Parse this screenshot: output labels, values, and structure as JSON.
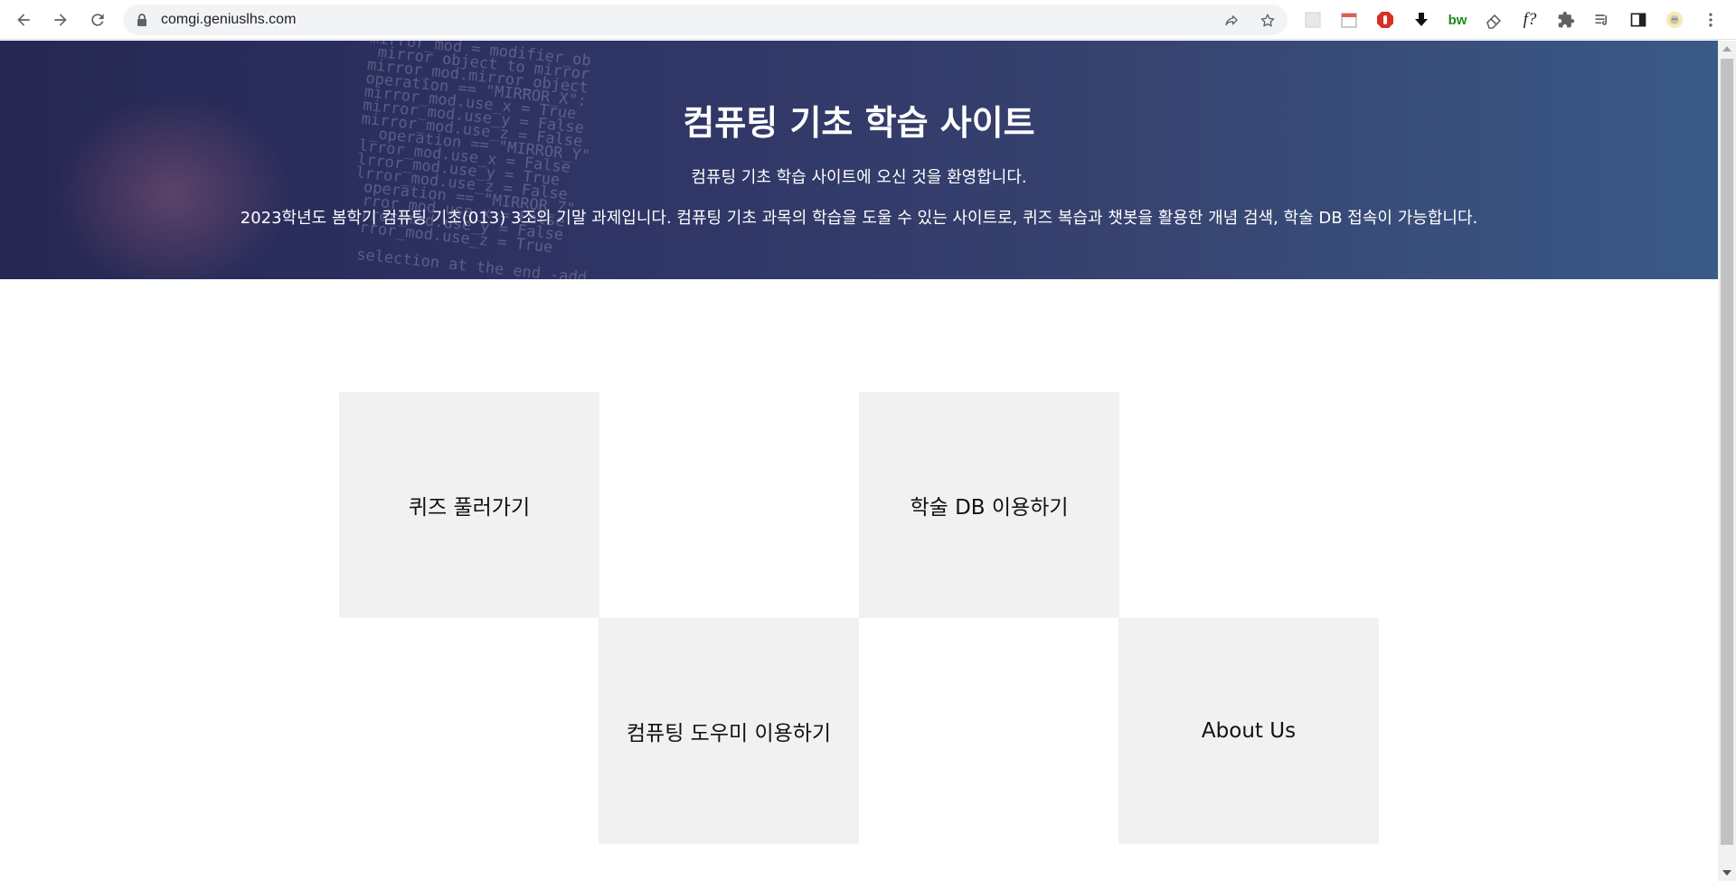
{
  "browser": {
    "url": "comgi.geniuslhs.com",
    "icons": [
      "back-icon",
      "forward-icon",
      "reload-icon",
      "lock-icon",
      "share-icon",
      "bookmark-star-icon"
    ],
    "extensions": [
      "ext-placeholder-icon",
      "ext-calendar-icon",
      "ext-adblock-icon",
      "ext-download-icon",
      "ext-bw-icon",
      "ext-eraser-icon",
      "ext-fx-icon",
      "ext-puzzle-icon",
      "reading-list-icon",
      "side-panel-icon",
      "profile-avatar",
      "menu-kebab-icon"
    ],
    "ext_bw_label": "bw",
    "ext_fx_label": "f?"
  },
  "hero": {
    "title": "컴퓨팅 기초 학습 사이트",
    "subtitle": "컴퓨팅 기초 학습 사이트에 오신 것을 환영합니다.",
    "description": "2023학년도 봄학기 컴퓨팅 기초(013) 3조의 기말 과제입니다. 컴퓨팅 기초 과목의 학습을 도울 수 있는 사이트로, 퀴즈 복습과 챗봇을 활용한 개념 검색, 학술 DB 접속이 가능합니다."
  },
  "tiles": [
    {
      "label": "퀴즈 풀러가기"
    },
    {
      "label": "학술 DB 이용하기"
    },
    {
      "label": "컴퓨팅 도우미 이용하기"
    },
    {
      "label": "About Us"
    }
  ],
  "colors": {
    "hero_dark": "#262752",
    "hero_light": "#3a5a87",
    "tile_bg": "#f1f1f1",
    "text_on_hero": "#ffffff"
  }
}
